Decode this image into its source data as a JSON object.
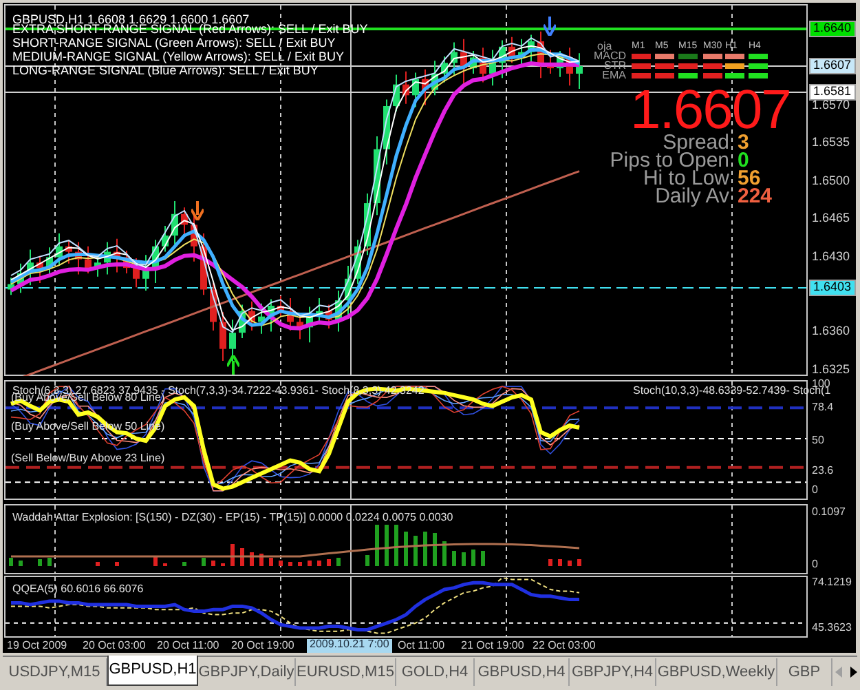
{
  "chart": {
    "symbol_line": "GBPUSD,H1  1.6608 1.6629 1.6600 1.6607",
    "signals": [
      "EXTRA SHORT-RANGE SIGNAL (Red Arrows): SELL / Exit BUY",
      "SHORT-RANGE SIGNAL (Green Arrows): SELL / Exit BUY",
      "MEDIUM-RANGE SIGNAL (Yellow Arrows): SELL / Exit BUY",
      "LONG-RANGE SIGNAL (Blue Arrows): SELL / Exit BUY"
    ],
    "price_labels": [
      {
        "text": "1.6640",
        "kind": "marker",
        "color": "#00e000"
      },
      {
        "text": "1.6607",
        "kind": "marker",
        "color": "#c8e8f8"
      },
      {
        "text": "1.6581",
        "kind": "marker",
        "color": "#ffffff"
      },
      {
        "text": "1.6570",
        "kind": "plain"
      },
      {
        "text": "1.6535",
        "kind": "plain"
      },
      {
        "text": "1.6500",
        "kind": "plain"
      },
      {
        "text": "1.6465",
        "kind": "plain"
      },
      {
        "text": "1.6430",
        "kind": "plain"
      },
      {
        "text": "1.6403",
        "kind": "marker",
        "color": "#40e0f0"
      },
      {
        "text": "1.6360",
        "kind": "plain"
      },
      {
        "text": "1.6325",
        "kind": "plain"
      }
    ]
  },
  "trend_panel": {
    "header": "oja",
    "columns": [
      "M1",
      "M5",
      "M15",
      "M30",
      "H1",
      "H4"
    ],
    "rows": [
      {
        "label": "MACD",
        "cells": [
          {
            "color": "#e02020"
          },
          {
            "color": "#e87a6a"
          },
          {
            "color": "#1a7a1a"
          },
          {
            "color": "#e87a6a"
          },
          {
            "color": "#e87a6a"
          },
          {
            "color": "#20e020"
          }
        ]
      },
      {
        "label": "STR",
        "cells": [
          {
            "color": "#e02020"
          },
          {
            "color": "#e02020"
          },
          {
            "color": "#e02020"
          },
          {
            "color": "#e02020"
          },
          {
            "color": "#f0a020"
          },
          {
            "color": "#20e020"
          }
        ]
      },
      {
        "label": "EMA",
        "cells": [
          {
            "color": "#e02020"
          },
          {
            "color": "#e02020"
          },
          {
            "color": "#20e020"
          },
          {
            "color": "#e02020"
          },
          {
            "color": "#20e020"
          },
          {
            "color": "#20e020"
          }
        ]
      }
    ]
  },
  "price": "1.6607",
  "stats": [
    {
      "label": "Spread",
      "value": "3",
      "color": "#f0a030"
    },
    {
      "label": "Pips to Open",
      "value": "0",
      "color": "#20e020"
    },
    {
      "label": "Hi to Low",
      "value": "56",
      "color": "#f0a030"
    },
    {
      "label": "Daily Av",
      "value": "224",
      "color": "#f06040"
    }
  ],
  "stoch_panel": {
    "title": "Stoch(6,3,3) 27.6823 37.9435 - Stoch(7,3,3)-34.7222-43.9361- Stoch(8,3,3) 42.3242",
    "title_end": "Stoch(10,3,3)-48.6339-52.7439- Stoch(1",
    "level_notes": [
      "(Buy Above/Sell Below 80 Line)",
      "(Buy Above/Sell Below 50 Line)",
      "(Sell Below/Buy Above 23 Line)"
    ],
    "axis_labels": [
      "100",
      "78.4",
      "50",
      "23.6",
      "0"
    ]
  },
  "waddah_panel": {
    "title": "Waddah Attar Explosion: [S(150) - DZ(30) - EP(15) - TP(15)] 0.0000 0.0224 0.0075 0.0030",
    "axis_labels": [
      "0.1097",
      "0"
    ]
  },
  "qqe_panel": {
    "title": "QQEA(5) 60.6016 66.6076",
    "axis_labels": [
      "74.1219",
      "45.3623"
    ]
  },
  "time_axis": [
    {
      "text": "19 Oct 2009",
      "kind": "plain"
    },
    {
      "text": "20 Oct 03:00",
      "kind": "plain"
    },
    {
      "text": "20 Oct 11:00",
      "kind": "plain"
    },
    {
      "text": "20 Oct 19:00",
      "kind": "plain"
    },
    {
      "text": "2009.10.21 7:00",
      "kind": "cursor"
    },
    {
      "text": "Oct 11:00",
      "kind": "plain"
    },
    {
      "text": "21 Oct 19:00",
      "kind": "plain"
    },
    {
      "text": "22 Oct 03:00",
      "kind": "plain"
    }
  ],
  "tabs": [
    {
      "label": "USDJPY,M15",
      "selected": false
    },
    {
      "label": "GBPUSD,H1",
      "selected": true
    },
    {
      "label": "GBPJPY,Daily",
      "selected": false
    },
    {
      "label": "EURUSD,M15",
      "selected": false
    },
    {
      "label": "GOLD,H4",
      "selected": false
    },
    {
      "label": "GBPUSD,H4",
      "selected": false
    },
    {
      "label": "GBPJPY,H4",
      "selected": false
    },
    {
      "label": "GBPUSD,Weekly",
      "selected": false
    },
    {
      "label": "GBP",
      "selected": false
    }
  ]
}
